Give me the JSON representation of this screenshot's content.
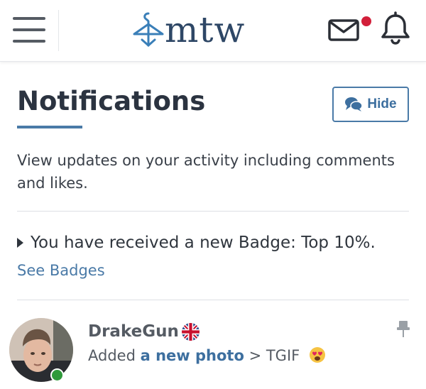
{
  "header": {
    "logo_text": "mtw",
    "icons": [
      "menu-icon",
      "hanger-icon",
      "mail-icon",
      "bell-icon"
    ],
    "mail_unread": true,
    "accent_color": "#4a7aa7",
    "unread_color": "#d21f3a"
  },
  "page": {
    "title": "Notifications",
    "hide_label": "Hide",
    "intro": "View updates on your activity including comments and likes."
  },
  "badge_notice": {
    "text": "You have received a new Badge: Top 10%.",
    "link": "See Badges"
  },
  "notification": {
    "username": "DrakeGun",
    "flag": "uk-flag-icon",
    "online": true,
    "action": "Added",
    "link": "a new photo",
    "separator": ">",
    "target": "TGIF",
    "emoji": "heart-eyes-emoji"
  }
}
